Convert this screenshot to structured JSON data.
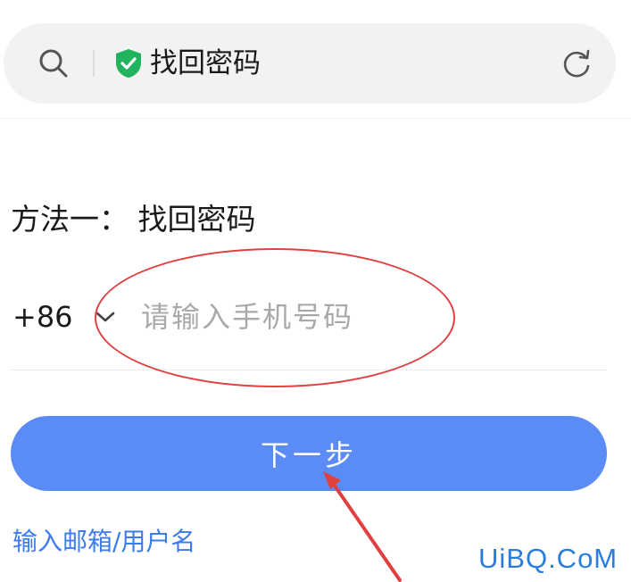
{
  "topbar": {
    "title": "找回密码",
    "icons": {
      "search": "search-icon",
      "secure": "shield-check-icon",
      "refresh": "refresh-icon"
    },
    "colors": {
      "background": "#f2f2f2",
      "shield": "#22b35e"
    }
  },
  "form": {
    "method_heading": "方法一： 找回密码",
    "country_code": "+86",
    "phone_placeholder": "请输入手机号码",
    "phone_value": "",
    "next_label": "下一步",
    "alt_link": "输入邮箱/用户名",
    "colors": {
      "button": "#5b8cf6",
      "link": "#3d7bf0",
      "placeholder": "#a9a9a9"
    }
  },
  "annotations": {
    "color": "#e04040"
  },
  "watermark": {
    "text": "UiBQ.CoM",
    "color": "#2a7ddb"
  }
}
